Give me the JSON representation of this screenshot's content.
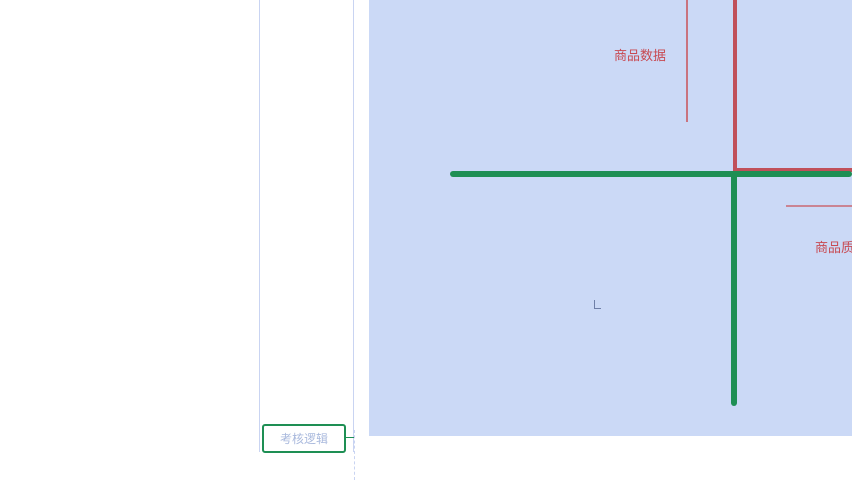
{
  "canvas": {
    "labels": {
      "product_data": "商品数据",
      "product_quality": "商品质"
    },
    "colors": {
      "canvas_bg": "#cbd9f6",
      "green_line": "#1e8f54",
      "red_line": "#c0505a"
    }
  },
  "outline": {
    "node_label": "考核逻辑"
  }
}
